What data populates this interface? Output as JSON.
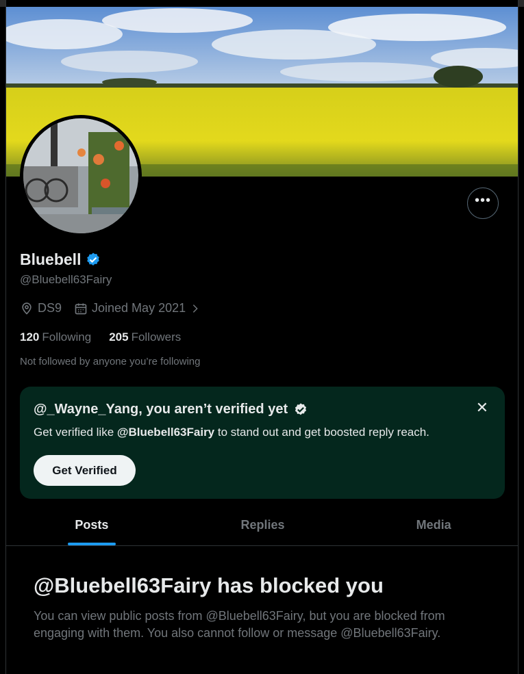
{
  "profile": {
    "name": "Bluebell",
    "handle": "@Bluebell63Fairy",
    "location": "DS9",
    "joined": "Joined May 2021",
    "following_count": "120",
    "following_label": "Following",
    "followers_count": "205",
    "followers_label": "Followers",
    "not_followed": "Not followed by anyone you’re following",
    "verified_badge_color": "#1d9bf0"
  },
  "verify_prompt": {
    "title": "@_Wayne_Yang, you aren’t verified yet",
    "desc_prefix": "Get verified like ",
    "desc_handle": "@Bluebell63Fairy",
    "desc_suffix": " to stand out and get boosted reply reach.",
    "button": "Get Verified",
    "close": "✕",
    "background": "#04271d"
  },
  "tabs": [
    {
      "label": "Posts",
      "active": true
    },
    {
      "label": "Replies",
      "active": false
    },
    {
      "label": "Media",
      "active": false
    }
  ],
  "blocked": {
    "title": "@Bluebell63Fairy has blocked you",
    "desc": "You can view public posts from @Bluebell63Fairy, but you are blocked from engaging with them. You also cannot follow or message @Bluebell63Fairy."
  },
  "icons": {
    "more": "more-horizontal-icon",
    "location": "location-pin-icon",
    "calendar": "calendar-icon",
    "chevron": "chevron-right-icon",
    "verified": "verified-badge-icon",
    "close": "close-icon"
  },
  "theme": {
    "accent": "#1d9bf0",
    "muted": "#71767b",
    "text": "#e7e9ea"
  }
}
